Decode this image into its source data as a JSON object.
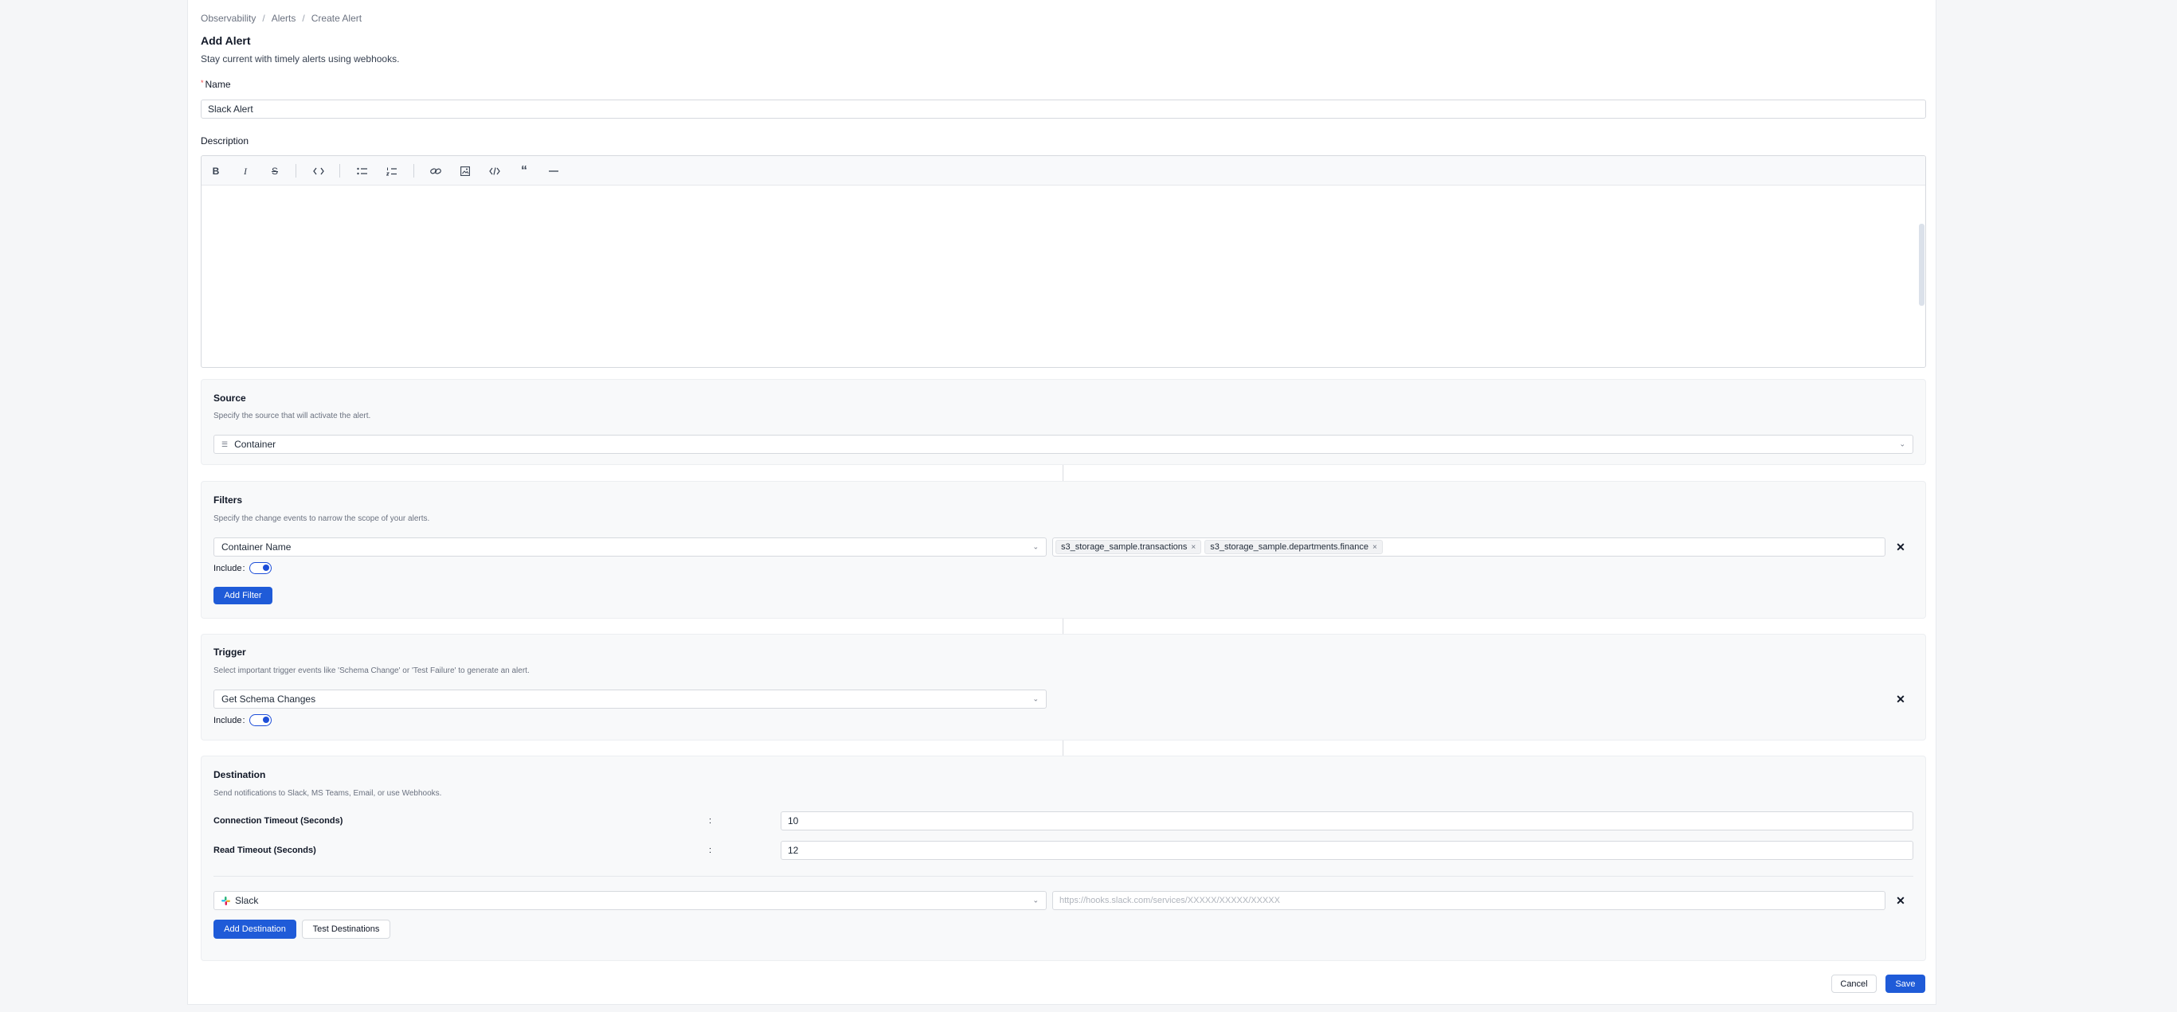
{
  "breadcrumb": [
    "Observability",
    "Alerts",
    "Create Alert"
  ],
  "header": {
    "title": "Add Alert",
    "subtitle": "Stay current with timely alerts using webhooks."
  },
  "name_field": {
    "required_mark": "*",
    "label": "Name",
    "value": "Slack Alert"
  },
  "description": {
    "label": "Description",
    "toolbar_icons": [
      "bold-icon",
      "italic-icon",
      "strikethrough-icon",
      "inline-code-icon",
      "bullet-list-icon",
      "ordered-list-icon",
      "link-icon",
      "image-icon",
      "code-block-icon",
      "quote-icon",
      "horizontal-rule-icon"
    ]
  },
  "source": {
    "title": "Source",
    "description": "Specify the source that will activate the alert.",
    "selected": "Container"
  },
  "filters": {
    "title": "Filters",
    "description": "Specify the change events to narrow the scope of your alerts.",
    "field": "Container Name",
    "tags": [
      "s3_storage_sample.transactions",
      "s3_storage_sample.departments.finance"
    ],
    "include_label": "Include",
    "include_on": true,
    "add_button": "Add Filter"
  },
  "trigger": {
    "title": "Trigger",
    "description": "Select important trigger events like 'Schema Change' or 'Test Failure' to generate an alert.",
    "selected": "Get Schema Changes",
    "include_label": "Include",
    "include_on": true
  },
  "destination": {
    "title": "Destination",
    "description": "Send notifications to Slack, MS Teams, Email, or use Webhooks.",
    "connection_timeout_label": "Connection Timeout (Seconds)",
    "connection_timeout_value": "10",
    "read_timeout_label": "Read Timeout (Seconds)",
    "read_timeout_value": "12",
    "colon": ":",
    "type": "Slack",
    "webhook_placeholder": "https://hooks.slack.com/services/XXXXX/XXXXX/XXXXX",
    "add_button": "Add Destination",
    "test_button": "Test Destinations"
  },
  "footer": {
    "cancel": "Cancel",
    "save": "Save"
  },
  "colors": {
    "primary": "#1f5bd8",
    "required": "#ef4444"
  }
}
